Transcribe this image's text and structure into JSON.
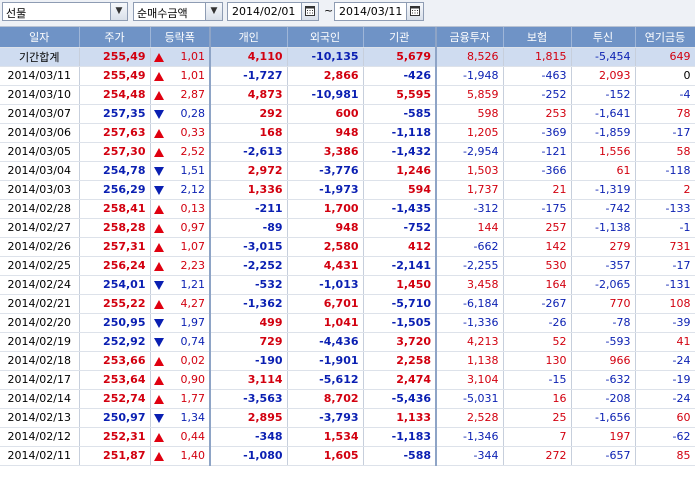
{
  "toolbar": {
    "market": "선물",
    "metric": "순매수금액",
    "date_from": "2014/02/01",
    "date_to": "2014/03/11",
    "tilde": "~"
  },
  "columns": [
    "일자",
    "주가",
    "등락폭",
    "개인",
    "외국인",
    "기관",
    "금융투자",
    "보험",
    "투신",
    "연기금등"
  ],
  "colors": {
    "up": "#d2000f",
    "down": "#0a1fb2",
    "header": "#6f93c6",
    "total_row": "#cfdcf0"
  },
  "rows": [
    {
      "date": "기간합계",
      "price": "255,49",
      "dir": "up",
      "change": "1,01",
      "indiv": "4,110",
      "foreign": "-10,135",
      "inst": "5,679",
      "fin": "8,526",
      "ins": "1,815",
      "trust": "-5,454",
      "pension": "649",
      "total": true
    },
    {
      "date": "2014/03/11",
      "price": "255,49",
      "dir": "up",
      "change": "1,01",
      "indiv": "-1,727",
      "foreign": "2,866",
      "inst": "-426",
      "fin": "-1,948",
      "ins": "-463",
      "trust": "2,093",
      "pension": "0"
    },
    {
      "date": "2014/03/10",
      "price": "254,48",
      "dir": "up",
      "change": "2,87",
      "indiv": "4,873",
      "foreign": "-10,981",
      "inst": "5,595",
      "fin": "5,859",
      "ins": "-252",
      "trust": "-152",
      "pension": "-4"
    },
    {
      "date": "2014/03/07",
      "price": "257,35",
      "dir": "down",
      "change": "0,28",
      "indiv": "292",
      "foreign": "600",
      "inst": "-585",
      "fin": "598",
      "ins": "253",
      "trust": "-1,641",
      "pension": "78"
    },
    {
      "date": "2014/03/06",
      "price": "257,63",
      "dir": "up",
      "change": "0,33",
      "indiv": "168",
      "foreign": "948",
      "inst": "-1,118",
      "fin": "1,205",
      "ins": "-369",
      "trust": "-1,859",
      "pension": "-17"
    },
    {
      "date": "2014/03/05",
      "price": "257,30",
      "dir": "up",
      "change": "2,52",
      "indiv": "-2,613",
      "foreign": "3,386",
      "inst": "-1,432",
      "fin": "-2,954",
      "ins": "-121",
      "trust": "1,556",
      "pension": "58"
    },
    {
      "date": "2014/03/04",
      "price": "254,78",
      "dir": "down",
      "change": "1,51",
      "indiv": "2,972",
      "foreign": "-3,776",
      "inst": "1,246",
      "fin": "1,503",
      "ins": "-366",
      "trust": "61",
      "pension": "-118"
    },
    {
      "date": "2014/03/03",
      "price": "256,29",
      "dir": "down",
      "change": "2,12",
      "indiv": "1,336",
      "foreign": "-1,973",
      "inst": "594",
      "fin": "1,737",
      "ins": "21",
      "trust": "-1,319",
      "pension": "2"
    },
    {
      "date": "2014/02/28",
      "price": "258,41",
      "dir": "up",
      "change": "0,13",
      "indiv": "-211",
      "foreign": "1,700",
      "inst": "-1,435",
      "fin": "-312",
      "ins": "-175",
      "trust": "-742",
      "pension": "-133"
    },
    {
      "date": "2014/02/27",
      "price": "258,28",
      "dir": "up",
      "change": "0,97",
      "indiv": "-89",
      "foreign": "948",
      "inst": "-752",
      "fin": "144",
      "ins": "257",
      "trust": "-1,138",
      "pension": "-1"
    },
    {
      "date": "2014/02/26",
      "price": "257,31",
      "dir": "up",
      "change": "1,07",
      "indiv": "-3,015",
      "foreign": "2,580",
      "inst": "412",
      "fin": "-662",
      "ins": "142",
      "trust": "279",
      "pension": "731"
    },
    {
      "date": "2014/02/25",
      "price": "256,24",
      "dir": "up",
      "change": "2,23",
      "indiv": "-2,252",
      "foreign": "4,431",
      "inst": "-2,141",
      "fin": "-2,255",
      "ins": "530",
      "trust": "-357",
      "pension": "-17"
    },
    {
      "date": "2014/02/24",
      "price": "254,01",
      "dir": "down",
      "change": "1,21",
      "indiv": "-532",
      "foreign": "-1,013",
      "inst": "1,450",
      "fin": "3,458",
      "ins": "164",
      "trust": "-2,065",
      "pension": "-131"
    },
    {
      "date": "2014/02/21",
      "price": "255,22",
      "dir": "up",
      "change": "4,27",
      "indiv": "-1,362",
      "foreign": "6,701",
      "inst": "-5,710",
      "fin": "-6,184",
      "ins": "-267",
      "trust": "770",
      "pension": "108"
    },
    {
      "date": "2014/02/20",
      "price": "250,95",
      "dir": "down",
      "change": "1,97",
      "indiv": "499",
      "foreign": "1,041",
      "inst": "-1,505",
      "fin": "-1,336",
      "ins": "-26",
      "trust": "-78",
      "pension": "-39"
    },
    {
      "date": "2014/02/19",
      "price": "252,92",
      "dir": "down",
      "change": "0,74",
      "indiv": "729",
      "foreign": "-4,436",
      "inst": "3,720",
      "fin": "4,213",
      "ins": "52",
      "trust": "-593",
      "pension": "41"
    },
    {
      "date": "2014/02/18",
      "price": "253,66",
      "dir": "up",
      "change": "0,02",
      "indiv": "-190",
      "foreign": "-1,901",
      "inst": "2,258",
      "fin": "1,138",
      "ins": "130",
      "trust": "966",
      "pension": "-24"
    },
    {
      "date": "2014/02/17",
      "price": "253,64",
      "dir": "up",
      "change": "0,90",
      "indiv": "3,114",
      "foreign": "-5,612",
      "inst": "2,474",
      "fin": "3,104",
      "ins": "-15",
      "trust": "-632",
      "pension": "-19"
    },
    {
      "date": "2014/02/14",
      "price": "252,74",
      "dir": "up",
      "change": "1,77",
      "indiv": "-3,563",
      "foreign": "8,702",
      "inst": "-5,436",
      "fin": "-5,031",
      "ins": "16",
      "trust": "-208",
      "pension": "-24"
    },
    {
      "date": "2014/02/13",
      "price": "250,97",
      "dir": "down",
      "change": "1,34",
      "indiv": "2,895",
      "foreign": "-3,793",
      "inst": "1,133",
      "fin": "2,528",
      "ins": "25",
      "trust": "-1,656",
      "pension": "60"
    },
    {
      "date": "2014/02/12",
      "price": "252,31",
      "dir": "up",
      "change": "0,44",
      "indiv": "-348",
      "foreign": "1,534",
      "inst": "-1,183",
      "fin": "-1,346",
      "ins": "7",
      "trust": "197",
      "pension": "-62"
    },
    {
      "date": "2014/02/11",
      "price": "251,87",
      "dir": "up",
      "change": "1,40",
      "indiv": "-1,080",
      "foreign": "1,605",
      "inst": "-588",
      "fin": "-344",
      "ins": "272",
      "trust": "-657",
      "pension": "85"
    }
  ]
}
